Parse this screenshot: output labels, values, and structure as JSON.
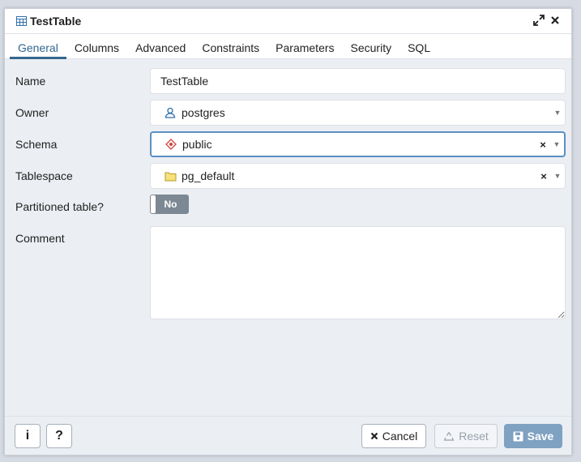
{
  "dialog": {
    "title": "TestTable",
    "title_icon": "table-icon",
    "controls": {
      "maximize_icon": "expand-icon",
      "close_icon": "close-icon"
    }
  },
  "tabs": [
    {
      "label": "General",
      "active": true
    },
    {
      "label": "Columns"
    },
    {
      "label": "Advanced"
    },
    {
      "label": "Constraints"
    },
    {
      "label": "Parameters"
    },
    {
      "label": "Security"
    },
    {
      "label": "SQL"
    }
  ],
  "form": {
    "name": {
      "label": "Name",
      "value": "TestTable"
    },
    "owner": {
      "label": "Owner",
      "value": "postgres",
      "icon": "user-icon"
    },
    "schema": {
      "label": "Schema",
      "value": "public",
      "icon": "schema-icon"
    },
    "tablespace": {
      "label": "Tablespace",
      "value": "pg_default",
      "icon": "folder-icon"
    },
    "partitioned": {
      "label": "Partitioned table?",
      "value": "No"
    },
    "comment": {
      "label": "Comment",
      "value": ""
    }
  },
  "footer": {
    "info_label": "i",
    "help_label": "?",
    "cancel_label": "Cancel",
    "reset_label": "Reset",
    "save_label": "Save"
  },
  "colors": {
    "accent": "#326690",
    "save_bg": "#7fa1c2",
    "toggle_bg": "#7c8893",
    "focus_border": "#5b8fc3"
  }
}
